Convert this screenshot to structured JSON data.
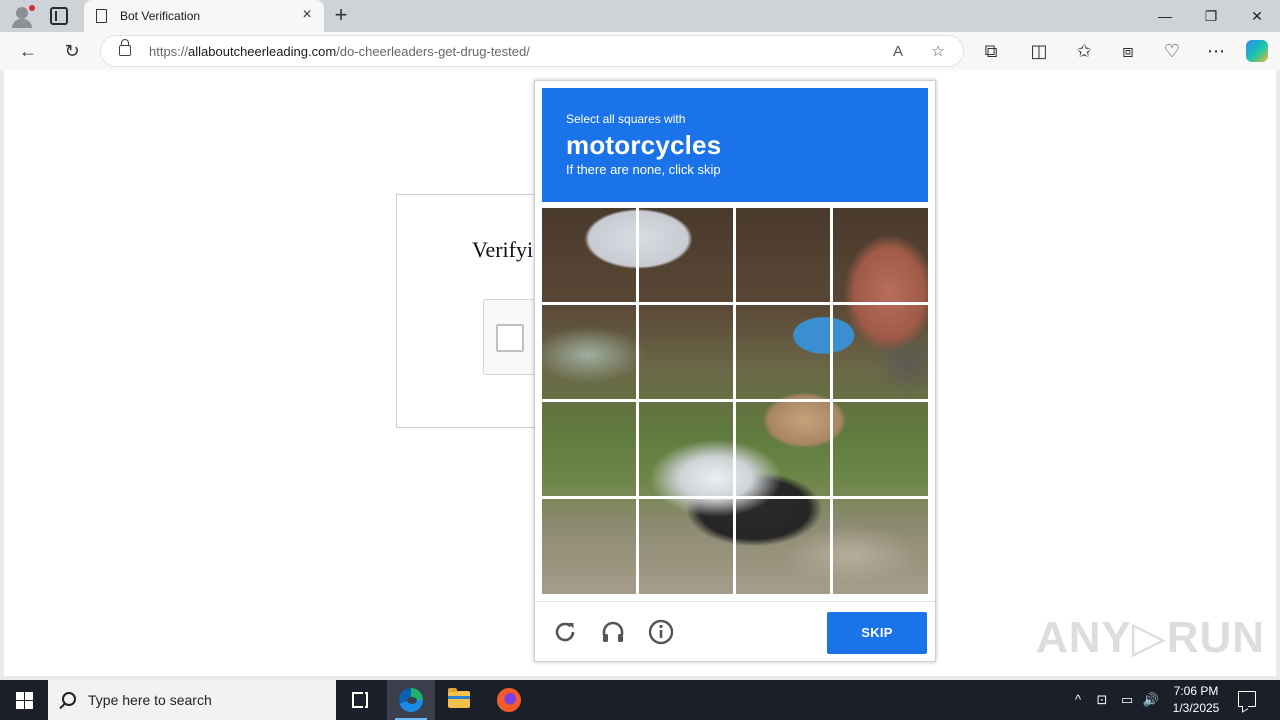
{
  "browser": {
    "tab_title": "Bot Verification",
    "url_prefix": "https://",
    "url_domain": "allaboutcheerleading.com",
    "url_path": "/do-cheerleaders-get-drug-tested/",
    "icons": {
      "profile": "profile-icon",
      "tabs": "tab-actions-icon",
      "new_tab": "+",
      "close_tab": "×",
      "minimize": "—",
      "maximize": "❐",
      "close_window": "✕",
      "back": "←",
      "refresh": "↻",
      "read_aloud": "A",
      "favorite": "☆",
      "extensions": "⧉",
      "split": "◫",
      "favorites": "✩",
      "collections": "⧈",
      "performance": "♡",
      "more": "⋯"
    }
  },
  "page": {
    "verify_title": "Verifyi"
  },
  "captcha": {
    "instruction_small": "Select all squares with",
    "target": "motorcycles",
    "instruction_sub": "If there are none, click skip",
    "skip_label": "SKIP",
    "grid_rows": 4,
    "grid_cols": 4,
    "accent": "#1a73e8"
  },
  "watermark": "ANY▷RUN",
  "taskbar": {
    "search_placeholder": "Type here to search",
    "time": "7:06 PM",
    "date": "1/3/2025",
    "tray": {
      "chevron": "^",
      "network": "▭",
      "volume": "🔊"
    }
  }
}
